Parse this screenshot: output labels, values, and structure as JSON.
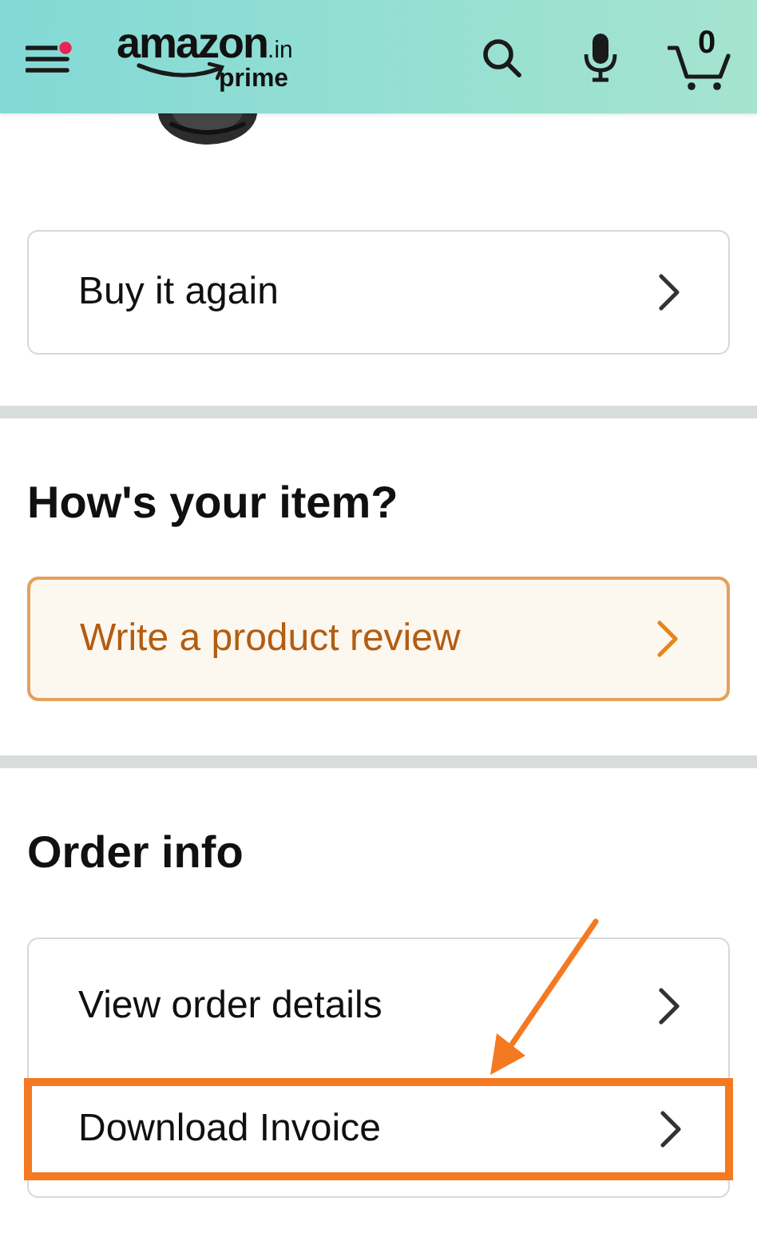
{
  "header": {
    "menu_badge": true,
    "logo": {
      "name": "amazon",
      "domain": ".in",
      "tier": "prime"
    },
    "cart_count": "0"
  },
  "buy_again": {
    "label": "Buy it again"
  },
  "review_section": {
    "heading": "How's your item?",
    "button": "Write a product review"
  },
  "order_info": {
    "heading": "Order info",
    "rows": [
      {
        "label": "View order details",
        "highlighted": false
      },
      {
        "label": "Download Invoice",
        "highlighted": true
      }
    ]
  }
}
